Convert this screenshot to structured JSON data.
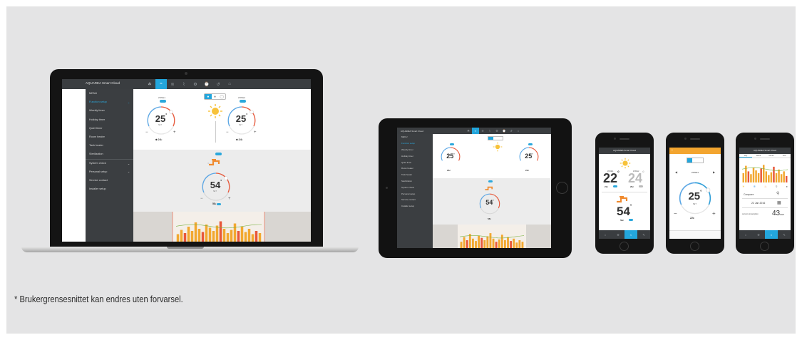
{
  "footnote": "* Brukergrensesnittet kan endres uten forvarsel.",
  "app": {
    "title": "AQUAREA Smart Cloud"
  },
  "sidebar": {
    "items": [
      {
        "label": "MENU",
        "active": false,
        "chevron": false
      },
      {
        "label": "Function setup",
        "active": true,
        "chevron": true
      },
      {
        "label": "Weekly timer",
        "active": false,
        "chevron": false
      },
      {
        "label": "Holiday timer",
        "active": false,
        "chevron": false
      },
      {
        "label": "Quiet timer",
        "active": false,
        "chevron": false
      },
      {
        "label": "Room heater",
        "active": false,
        "chevron": false
      },
      {
        "label": "Tank heater",
        "active": false,
        "chevron": false
      },
      {
        "label": "Sterilization",
        "active": false,
        "chevron": false
      },
      {
        "label": "System check",
        "active": false,
        "chevron": true
      },
      {
        "label": "Personal setup",
        "active": false,
        "chevron": true
      },
      {
        "label": "Service contact",
        "active": false,
        "chevron": false
      },
      {
        "label": "Installer setup",
        "active": false,
        "chevron": false
      }
    ]
  },
  "iconbar": [
    {
      "icon": "plant-icon",
      "glyph": "☘",
      "active": false
    },
    {
      "icon": "thermostat-icon",
      "glyph": "≈",
      "active": true
    },
    {
      "icon": "flow-icon",
      "glyph": "≋",
      "active": false
    },
    {
      "icon": "chart-icon",
      "glyph": "⌇",
      "active": false
    },
    {
      "icon": "energy-icon",
      "glyph": "⚙",
      "active": false
    },
    {
      "icon": "timer-icon",
      "glyph": "⌚",
      "active": false
    },
    {
      "icon": "history-icon",
      "glyph": "↺",
      "active": false
    },
    {
      "icon": "lock-icon",
      "glyph": "⌂",
      "active": false
    }
  ],
  "laptop": {
    "zone1": {
      "label": "ZONE1",
      "value": "25",
      "unit": "°",
      "set": "SET",
      "indoor": "24",
      "indoor_unit": "c"
    },
    "zone2": {
      "label": "ZONE2",
      "value": "25",
      "unit": "°",
      "set": "SET",
      "indoor": "24",
      "indoor_unit": "c"
    },
    "tank": {
      "value": "54",
      "unit": "°",
      "set": "SET",
      "current": "58",
      "current_unit": "c"
    },
    "mode_buttons": [
      "heat-mode",
      "cool-mode",
      "auto-mode"
    ]
  },
  "phone1": {
    "title": "AQUAREA Smart Cloud",
    "zone1_label": "ZONE1",
    "zone1_value": "22",
    "zone1_unit": "°",
    "zone1_sub": "21c",
    "zone2_label": "ZONE2",
    "zone2_value": "24",
    "zone2_unit": "°",
    "zone2_sub": "26c",
    "tank_value": "54",
    "tank_unit": "°",
    "tank_sub": "58c"
  },
  "phone2": {
    "zone_label": "ZONE1",
    "value": "25",
    "unit": "°",
    "set": "SET",
    "indoor": "22",
    "indoor_unit": "c"
  },
  "phone3": {
    "title": "AQUAREA Smart Cloud",
    "tabs": [
      "Day",
      "Week",
      "Month",
      "Year"
    ],
    "compare_label": "Compare",
    "date": "22 Jan 2016",
    "consumption_label": "current consumption",
    "consumption_value": "43",
    "consumption_unit": "kWh"
  },
  "colors": {
    "accent": "#23a6dc",
    "sidebar": "#3b3e41",
    "header": "#3a3d40",
    "orange": "#f3a52f",
    "bars": "#f2a830",
    "panel": "#e4e4e5"
  }
}
